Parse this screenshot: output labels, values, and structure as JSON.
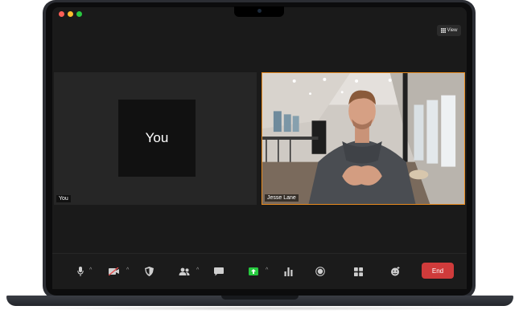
{
  "window": {
    "view_label": "View"
  },
  "participants": [
    {
      "name": "You",
      "placeholder_text": "You",
      "active_speaker": false
    },
    {
      "name": "Jesse Lane",
      "active_speaker": true
    }
  ],
  "toolbar": {
    "end_label": "End",
    "icons": [
      "microphone-icon",
      "video-off-icon",
      "security-icon",
      "participants-icon",
      "chat-icon",
      "share-screen-icon",
      "polls-icon",
      "record-icon",
      "apps-icon",
      "reactions-icon"
    ]
  },
  "colors": {
    "active_speaker_border": "#e88b1f",
    "end_button": "#cf3b3b",
    "share_icon": "#27c93f"
  }
}
